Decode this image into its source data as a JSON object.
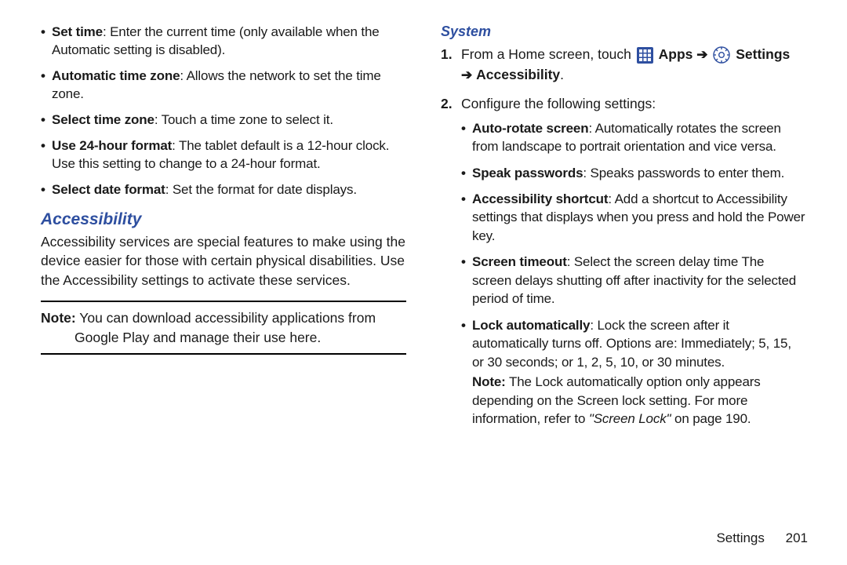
{
  "left": {
    "bullets": [
      {
        "term": "Set time",
        "desc": ": Enter the current time (only available when the Automatic setting is disabled)."
      },
      {
        "term": "Automatic time zone",
        "desc": ": Allows the network to set the time zone."
      },
      {
        "term": "Select time zone",
        "desc": ": Touch a time zone to select it."
      },
      {
        "term": "Use 24-hour format",
        "desc": ": The tablet default is a 12-hour clock. Use this setting to change to a 24-hour format."
      },
      {
        "term": "Select date format",
        "desc": ": Set the format for date displays."
      }
    ],
    "heading": "Accessibility",
    "intro": "Accessibility services are special features to make using the device easier for those with certain physical disabilities. Use the Accessibility settings to activate these services.",
    "note_label": "Note:",
    "note_rest": " You can download accessibility applications from Google Play and manage their use here."
  },
  "right": {
    "heading": "System",
    "step1_pre": "From a Home screen, touch ",
    "apps_label": " Apps ",
    "arrow1": "➔",
    "settings_label": " Settings ",
    "arrow2": "➔",
    "accessibility_label": " Accessibility",
    "period": ".",
    "step2": "Configure the following settings:",
    "sub": [
      {
        "term": "Auto-rotate screen",
        "desc": ": Automatically rotates the screen from landscape to portrait orientation and vice versa."
      },
      {
        "term": "Speak passwords",
        "desc": ": Speaks passwords to enter them."
      },
      {
        "term": "Accessibility shortcut",
        "desc": ": Add a shortcut to Accessibility settings that displays when you press and hold the Power key."
      },
      {
        "term": "Screen timeout",
        "desc": ": Select the screen delay time The screen delays shutting off after inactivity for the selected period of time."
      },
      {
        "term": "Lock automatically",
        "desc": ": Lock the screen after it automatically turns off. Options are: Immediately; 5, 15, or 30 seconds; or 1, 2, 5, 10, or 30 minutes."
      }
    ],
    "note2_label": "Note:",
    "note2_rest": " The Lock automatically option only appears depending on the Screen lock setting. For more information, refer to ",
    "xref_italic": "\"Screen Lock\"",
    "xref_plain": " on page 190."
  },
  "footer": {
    "chapter": "Settings",
    "page": "201"
  }
}
